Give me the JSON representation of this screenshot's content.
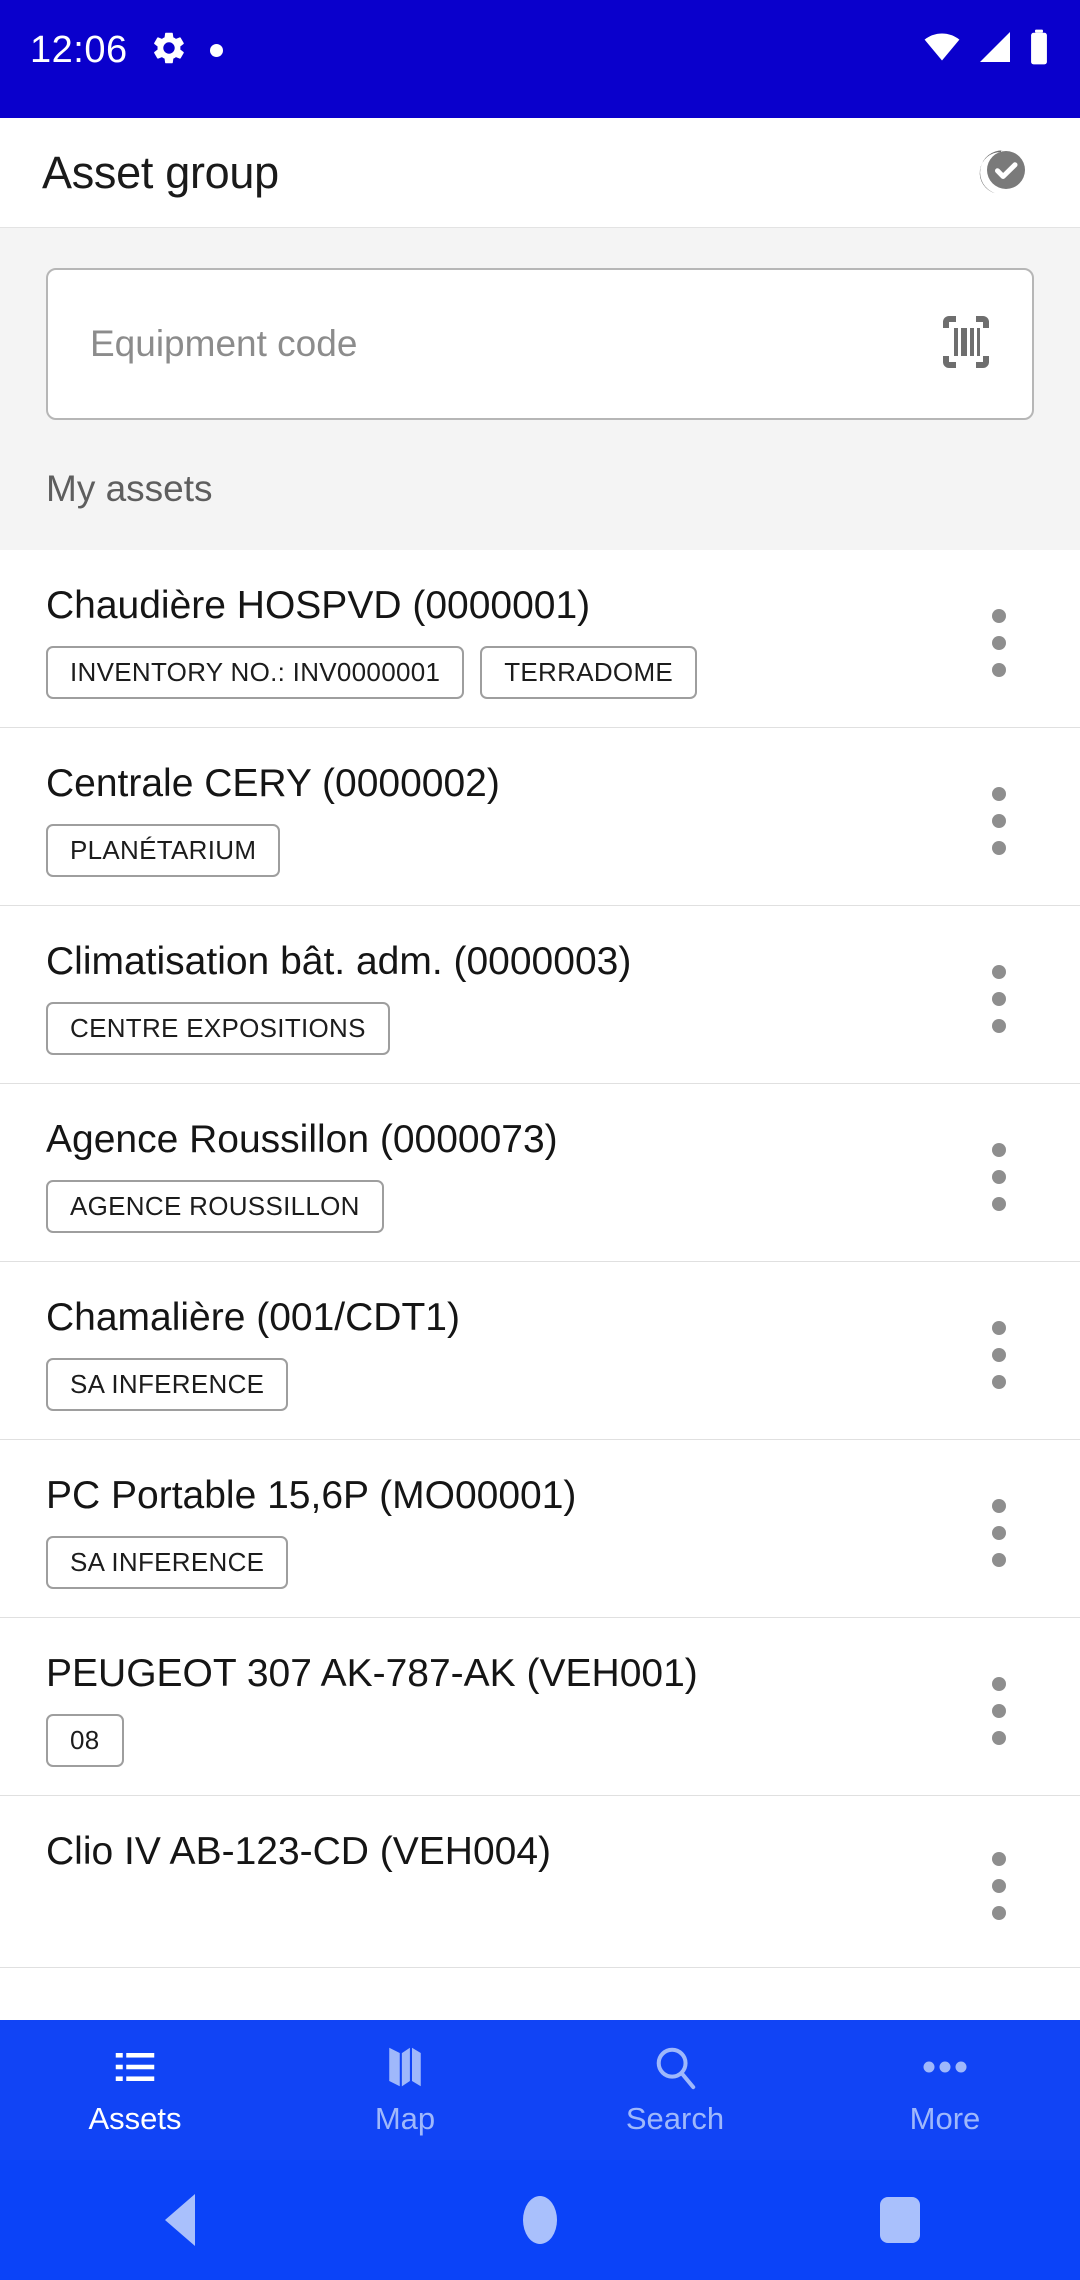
{
  "status_bar": {
    "time": "12:06",
    "icons_left": [
      "gear-icon",
      "dot-icon"
    ],
    "icons_right": [
      "wifi-icon",
      "cellular-signal-icon",
      "battery-icon"
    ],
    "background_color": "#0A00CC"
  },
  "app_bar": {
    "title": "Asset group",
    "action_icon": "check-circle-icon"
  },
  "search": {
    "placeholder": "Equipment code",
    "value": "",
    "scan_icon": "barcode-scan-icon"
  },
  "section": {
    "label": "My assets"
  },
  "assets": [
    {
      "title": "Chaudière HOSPVD (0000001)",
      "chips": [
        "INVENTORY NO.: INV0000001",
        "TERRADOME"
      ]
    },
    {
      "title": "Centrale CERY (0000002)",
      "chips": [
        "PLANÉTARIUM"
      ]
    },
    {
      "title": "Climatisation bât. adm. (0000003)",
      "chips": [
        "CENTRE EXPOSITIONS"
      ]
    },
    {
      "title": "Agence Roussillon (0000073)",
      "chips": [
        "AGENCE ROUSSILLON"
      ]
    },
    {
      "title": "Chamalière (001/CDT1)",
      "chips": [
        "SA INFERENCE"
      ]
    },
    {
      "title": "PC Portable 15,6P (MO00001)",
      "chips": [
        "SA INFERENCE"
      ]
    },
    {
      "title": "PEUGEOT 307 AK-787-AK (VEH001)",
      "chips": [
        "08"
      ]
    },
    {
      "title": "Clio IV AB-123-CD (VEH004)",
      "chips": []
    }
  ],
  "row_menu_icon": "more-vertical-icon",
  "bottom_nav": {
    "background_color": "#1144F5",
    "items": [
      {
        "label": "Assets",
        "icon": "list-icon",
        "active": true
      },
      {
        "label": "Map",
        "icon": "map-icon",
        "active": false
      },
      {
        "label": "Search",
        "icon": "search-icon",
        "active": false
      },
      {
        "label": "More",
        "icon": "more-horizontal-icon",
        "active": false
      }
    ]
  },
  "system_nav": {
    "background_color": "#0B43F8",
    "buttons": [
      "back-button",
      "home-button",
      "recents-button"
    ]
  }
}
